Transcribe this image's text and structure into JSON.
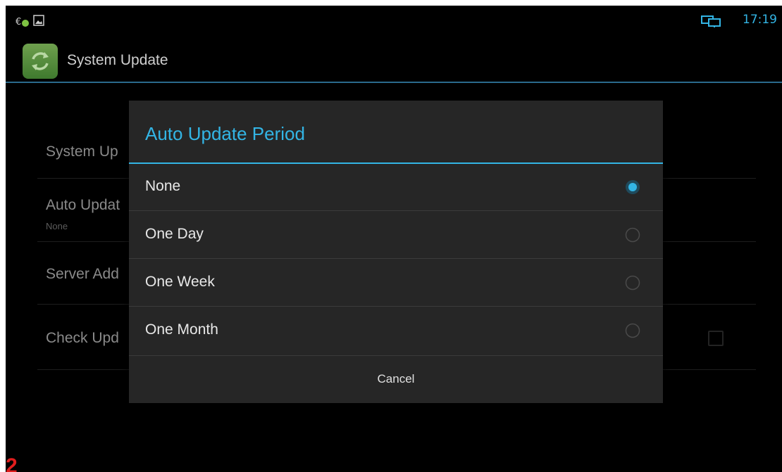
{
  "status_bar": {
    "time": "17:19",
    "icons": [
      "usb-icon",
      "image-icon",
      "network-icon"
    ],
    "accent_color": "#33b5e5"
  },
  "action_bar": {
    "title": "System Update",
    "icon": "system-update-icon"
  },
  "settings": {
    "items": [
      {
        "title": "System Up"
      },
      {
        "title": "Auto Updat",
        "summary": "None"
      },
      {
        "title": "Server Add"
      },
      {
        "title": "Check Upd",
        "checked": false
      }
    ]
  },
  "dialog": {
    "title": "Auto Update Period",
    "options": [
      {
        "label": "None",
        "selected": true
      },
      {
        "label": "One Day",
        "selected": false
      },
      {
        "label": "One Week",
        "selected": false
      },
      {
        "label": "One Month",
        "selected": false
      }
    ],
    "cancel_label": "Cancel"
  },
  "annotation": {
    "step_number": "2",
    "color": "#e11d1d"
  }
}
